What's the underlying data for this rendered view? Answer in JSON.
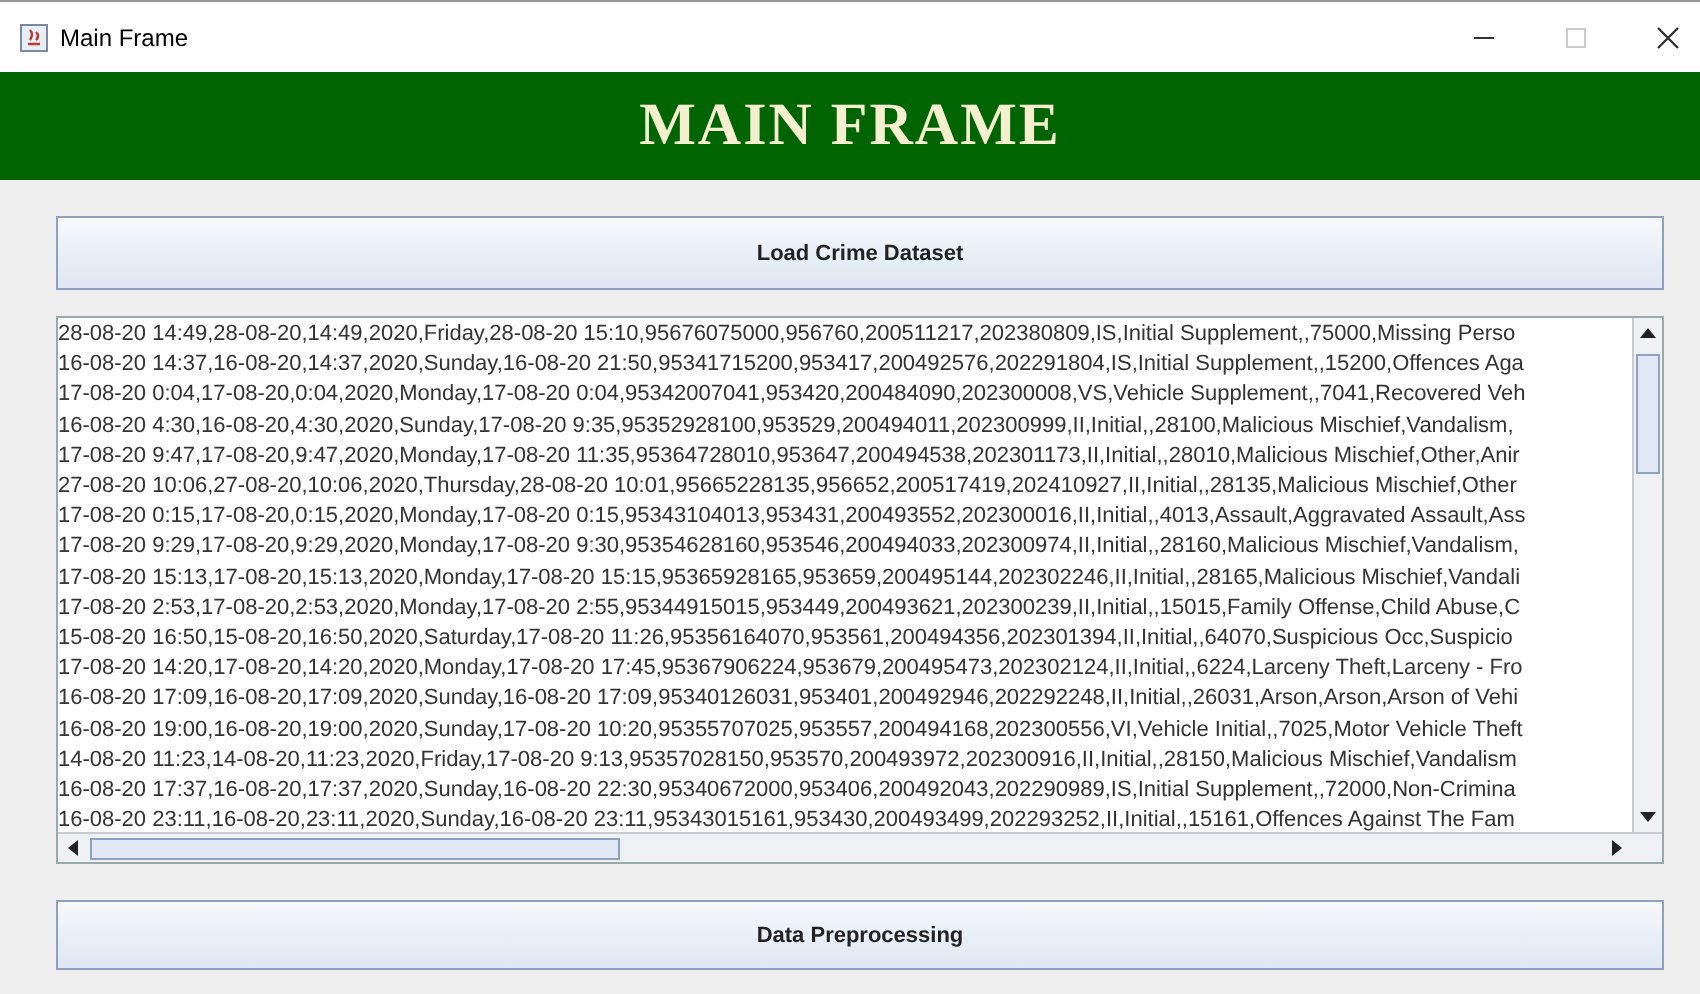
{
  "window": {
    "title": "Main Frame"
  },
  "header": {
    "title": "MAIN FRAME"
  },
  "buttons": [
    {
      "label": "Load Crime Dataset"
    },
    {
      "label": "Data Preprocessing"
    }
  ],
  "text_area": {
    "lines": [
      "28-08-20 14:49,28-08-20,14:49,2020,Friday,28-08-20 15:10,95676075000,956760,200511217,202380809,IS,Initial Supplement,,75000,Missing Perso",
      "16-08-20 14:37,16-08-20,14:37,2020,Sunday,16-08-20 21:50,95341715200,953417,200492576,202291804,IS,Initial Supplement,,15200,Offences Aga",
      "17-08-20 0:04,17-08-20,0:04,2020,Monday,17-08-20 0:04,95342007041,953420,200484090,202300008,VS,Vehicle Supplement,,7041,Recovered Veh",
      "16-08-20 4:30,16-08-20,4:30,2020,Sunday,17-08-20 9:35,95352928100,953529,200494011,202300999,II,Initial,,28100,Malicious Mischief,Vandalism,",
      "17-08-20 9:47,17-08-20,9:47,2020,Monday,17-08-20 11:35,95364728010,953647,200494538,202301173,II,Initial,,28010,Malicious Mischief,Other,Anir",
      "27-08-20 10:06,27-08-20,10:06,2020,Thursday,28-08-20 10:01,95665228135,956652,200517419,202410927,II,Initial,,28135,Malicious Mischief,Other",
      "17-08-20 0:15,17-08-20,0:15,2020,Monday,17-08-20 0:15,95343104013,953431,200493552,202300016,II,Initial,,4013,Assault,Aggravated Assault,Ass",
      "17-08-20 9:29,17-08-20,9:29,2020,Monday,17-08-20 9:30,95354628160,953546,200494033,202300974,II,Initial,,28160,Malicious Mischief,Vandalism,",
      "17-08-20 15:13,17-08-20,15:13,2020,Monday,17-08-20 15:15,95365928165,953659,200495144,202302246,II,Initial,,28165,Malicious Mischief,Vandali",
      "17-08-20 2:53,17-08-20,2:53,2020,Monday,17-08-20 2:55,95344915015,953449,200493621,202300239,II,Initial,,15015,Family Offense,Child Abuse,C",
      "15-08-20 16:50,15-08-20,16:50,2020,Saturday,17-08-20 11:26,95356164070,953561,200494356,202301394,II,Initial,,64070,Suspicious Occ,Suspicio",
      "17-08-20 14:20,17-08-20,14:20,2020,Monday,17-08-20 17:45,95367906224,953679,200495473,202302124,II,Initial,,6224,Larceny Theft,Larceny - Fro",
      "16-08-20 17:09,16-08-20,17:09,2020,Sunday,16-08-20 17:09,95340126031,953401,200492946,202292248,II,Initial,,26031,Arson,Arson,Arson of Vehi",
      "16-08-20 19:00,16-08-20,19:00,2020,Sunday,17-08-20 10:20,95355707025,953557,200494168,202300556,VI,Vehicle Initial,,7025,Motor Vehicle Theft",
      "14-08-20 11:23,14-08-20,11:23,2020,Friday,17-08-20 9:13,95357028150,953570,200493972,202300916,II,Initial,,28150,Malicious Mischief,Vandalism",
      "16-08-20 17:37,16-08-20,17:37,2020,Sunday,16-08-20 22:30,95340672000,953406,200492043,202290989,IS,Initial Supplement,,72000,Non-Crimina",
      "16-08-20 23:11,16-08-20,23:11,2020,Sunday,16-08-20 23:11,95343015161,953430,200493499,202293252,II,Initial,,15161,Offences Against The Fam"
    ]
  }
}
